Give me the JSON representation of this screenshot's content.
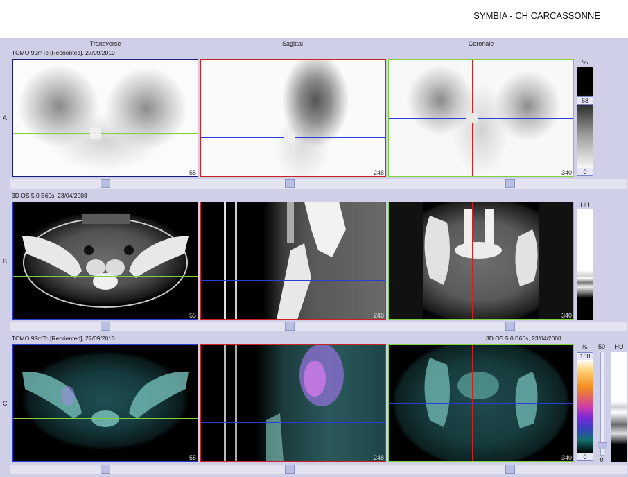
{
  "header": {
    "hospital": "SYMBIA - CH CARCASSONNE"
  },
  "columns": [
    "Transverse",
    "Sagittal",
    "Coronale"
  ],
  "rows": {
    "A": {
      "label": "A",
      "info": "TOMO 99mTc [Reoriented], 27/09/2010"
    },
    "B": {
      "label": "B",
      "info": "3D  OS  5.0  B60s, 23/04/2008"
    },
    "C": {
      "label": "C",
      "info_left": "TOMO 99mTc [Reoriented], 27/09/2010",
      "info_right": "3D  OS  5.0  B60s, 23/04/2008"
    }
  },
  "slices": [
    "55",
    "248",
    "340"
  ],
  "colorbars": {
    "spect": {
      "unit": "%",
      "max": "68",
      "min": "0"
    },
    "ct": {
      "unit": "HU"
    },
    "fusion": {
      "unit": "%",
      "max": "100",
      "min": "0",
      "blend_top": "50",
      "blend_bottom": "0",
      "ct_unit": "HU"
    }
  },
  "colors": {
    "red": "#cc2222",
    "green": "#7fd23a",
    "blue": "#2a3fd8",
    "border_bg": "#cfd0e8"
  }
}
